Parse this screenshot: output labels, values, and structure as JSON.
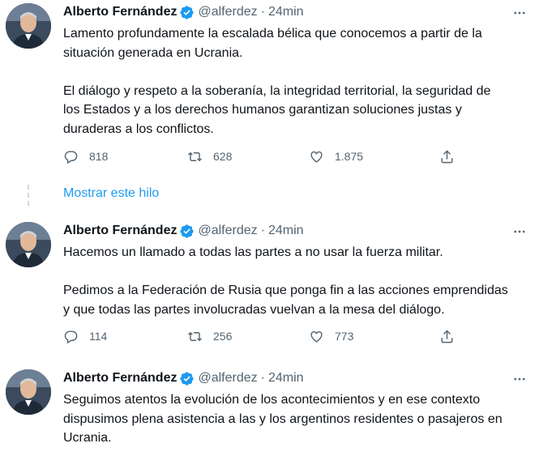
{
  "tweets": [
    {
      "name": "Alberto Fernández",
      "handle": "@alferdez",
      "dot": "·",
      "time": "24min",
      "paragraphs": [
        "Lamento profundamente la escalada bélica que conocemos a partir de la\nsituación generada en Ucrania.",
        "El diálogo y respeto a la soberanía, la integridad territorial, la seguridad de\nlos Estados y a los derechos humanos garantizan soluciones justas y\nduraderas a los conflictos."
      ],
      "replies": "818",
      "retweets": "628",
      "likes": "1.875"
    },
    {
      "name": "Alberto Fernández",
      "handle": "@alferdez",
      "dot": "·",
      "time": "24min",
      "paragraphs": [
        "Hacemos un llamado a todas las partes a no usar la fuerza militar.",
        "Pedimos a la Federación de Rusia que ponga fin a las acciones emprendidas\ny que todas las partes involucradas vuelvan a la mesa del diálogo."
      ],
      "replies": "114",
      "retweets": "256",
      "likes": "773"
    },
    {
      "name": "Alberto Fernández",
      "handle": "@alferdez",
      "dot": "·",
      "time": "24min",
      "paragraphs": [
        "Seguimos atentos la evolución de los acontecimientos y en ese contexto\ndispusimos plena asistencia a las y los argentinos residentes o pasajeros en\nUcrania."
      ]
    }
  ],
  "show_thread": "Mostrar este hilo",
  "colors": {
    "accent": "#1d9bf0",
    "muted": "#536471",
    "text": "#0f1419"
  }
}
